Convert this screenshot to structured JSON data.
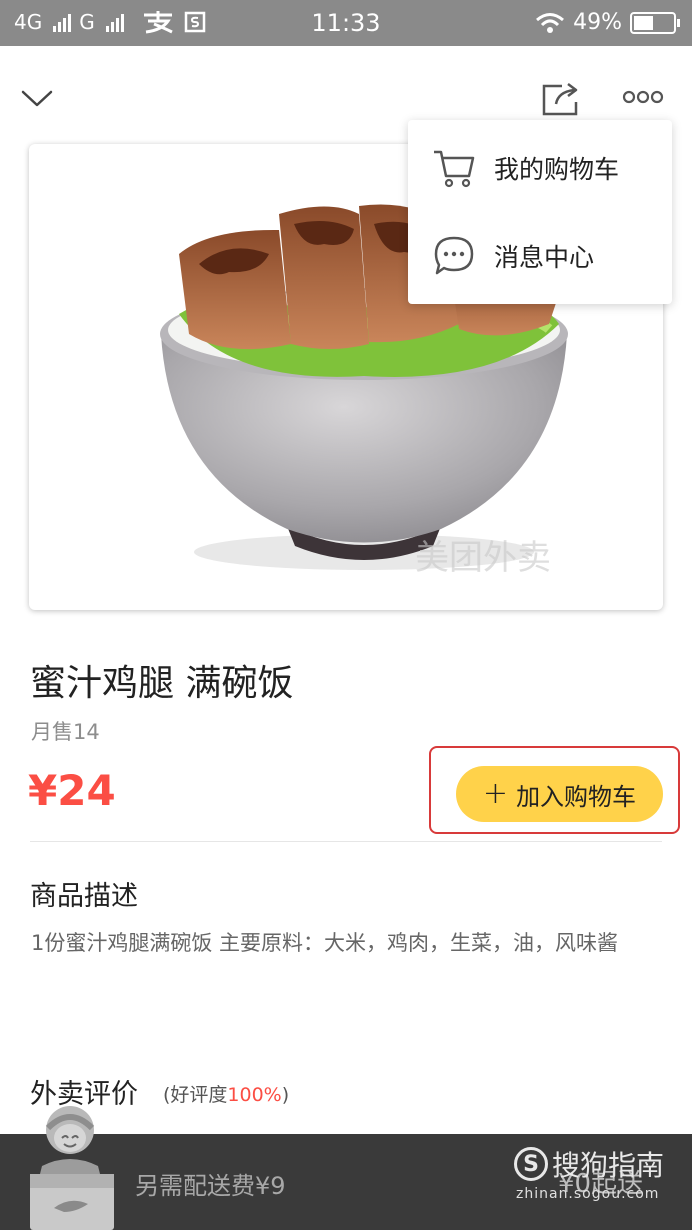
{
  "status_bar": {
    "network_1": "4G",
    "network_2": "G",
    "time": "11:33",
    "battery": "49%",
    "battery_level": 0.49,
    "app_icons": [
      "alipay-icon",
      "coupon-icon"
    ]
  },
  "nav": {
    "icons": [
      "chevron-down-icon",
      "share-icon",
      "more-icon"
    ]
  },
  "popup_menu": {
    "items": [
      {
        "icon": "cart-icon",
        "label": "我的购物车"
      },
      {
        "icon": "message-icon",
        "label": "消息中心"
      }
    ]
  },
  "product": {
    "title": "蜜汁鸡腿 满碗饭",
    "monthly_sales": "月售14",
    "price": "¥24",
    "add_to_cart": "加入购物车",
    "image_watermark": "美团外卖"
  },
  "description": {
    "heading": "商品描述",
    "text": "1份蜜汁鸡腿满碗饭 主要原料：大米，鸡肉，生菜，油，风味酱"
  },
  "reviews": {
    "heading": "外卖评价",
    "good_rate_prefix": "(好评度",
    "good_rate_value": "100%",
    "good_rate_suffix": ")"
  },
  "bottom_bar": {
    "delivery_fee": "另需配送费¥9",
    "min_order": "¥0起送",
    "overlay_brand": "搜狗指南",
    "overlay_url": "zhinan.sogou.com"
  },
  "colors": {
    "price": "#fb4e44",
    "button": "#ffd24a",
    "highlight_border": "#d83a3a",
    "bottom_bar": "#3a3a3a"
  }
}
